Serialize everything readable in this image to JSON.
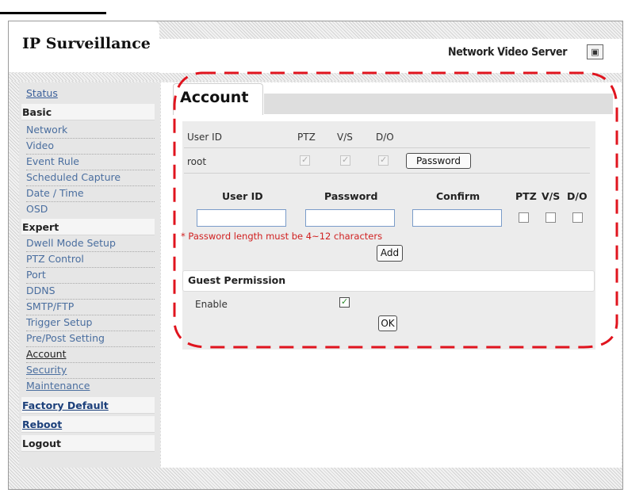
{
  "header": {
    "logo_text": "IP Surveillance",
    "product_name": "Network Video Server",
    "snapshot_icon": "camera-icon"
  },
  "sidebar": {
    "status": "Status",
    "basic": {
      "heading": "Basic",
      "items": [
        "Network",
        "Video",
        "Event Rule",
        "Scheduled Capture",
        "Date / Time",
        "OSD"
      ]
    },
    "expert": {
      "heading": "Expert",
      "items": [
        "Dwell Mode Setup",
        "PTZ Control",
        "Port",
        "DDNS",
        "SMTP/FTP",
        "Trigger Setup",
        "Pre/Post Setting",
        "Account",
        "Security",
        "Maintenance"
      ]
    },
    "factory_default": "Factory Default",
    "reboot": "Reboot",
    "logout": "Logout"
  },
  "main": {
    "title": "Account",
    "table": {
      "headers": [
        "User ID",
        "PTZ",
        "V/S",
        "D/O"
      ],
      "rows": [
        {
          "user_id": "root",
          "ptz": true,
          "vs": true,
          "do": true
        }
      ],
      "password_button": "Password"
    },
    "add_form": {
      "headers": {
        "user_id": "User ID",
        "password": "Password",
        "confirm": "Confirm",
        "ptz": "PTZ",
        "vs": "V/S",
        "do": "D/O"
      },
      "note": "* Password length must be 4~12 characters",
      "add_button": "Add"
    },
    "guest": {
      "title": "Guest Permission",
      "enable_label": "Enable",
      "enabled": true,
      "ok_button": "OK"
    }
  },
  "colors": {
    "link": "#3a5f9a",
    "highlight": "#e0141e",
    "note": "#d02020"
  }
}
